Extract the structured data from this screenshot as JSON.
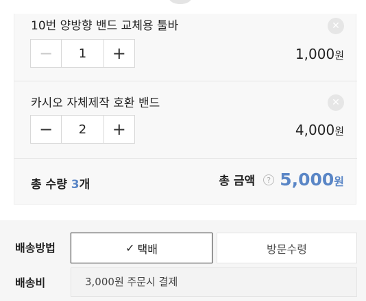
{
  "cart": {
    "items": [
      {
        "name": "10번 양방향 밴드 교체용 툴바",
        "quantity": "1",
        "price": "1,000",
        "currency": "원",
        "remove_icon": "close-icon",
        "decrement_disabled": true
      },
      {
        "name": "카시오 자체제작 호환 밴드",
        "quantity": "2",
        "price": "4,000",
        "currency": "원",
        "remove_icon": "close-icon",
        "decrement_disabled": false
      }
    ],
    "stepper": {
      "decrement": "−",
      "increment": "+"
    },
    "total": {
      "qty_label": "총 수량",
      "qty_value": "3",
      "qty_unit": "개",
      "amount_label": "총 금액",
      "help_symbol": "?",
      "amount_value": "5,000",
      "currency": "원"
    }
  },
  "shipping": {
    "method_label": "배송방법",
    "options": [
      {
        "label": "택배",
        "selected": true,
        "check": "✓"
      },
      {
        "label": "방문수령",
        "selected": false
      }
    ],
    "fee_label": "배송비",
    "fee_value": "3,000원 주문시 결제"
  },
  "colors": {
    "accent": "#5a86c6",
    "card_bg": "#f8f8f8",
    "band_bg": "#f6f6f6"
  }
}
